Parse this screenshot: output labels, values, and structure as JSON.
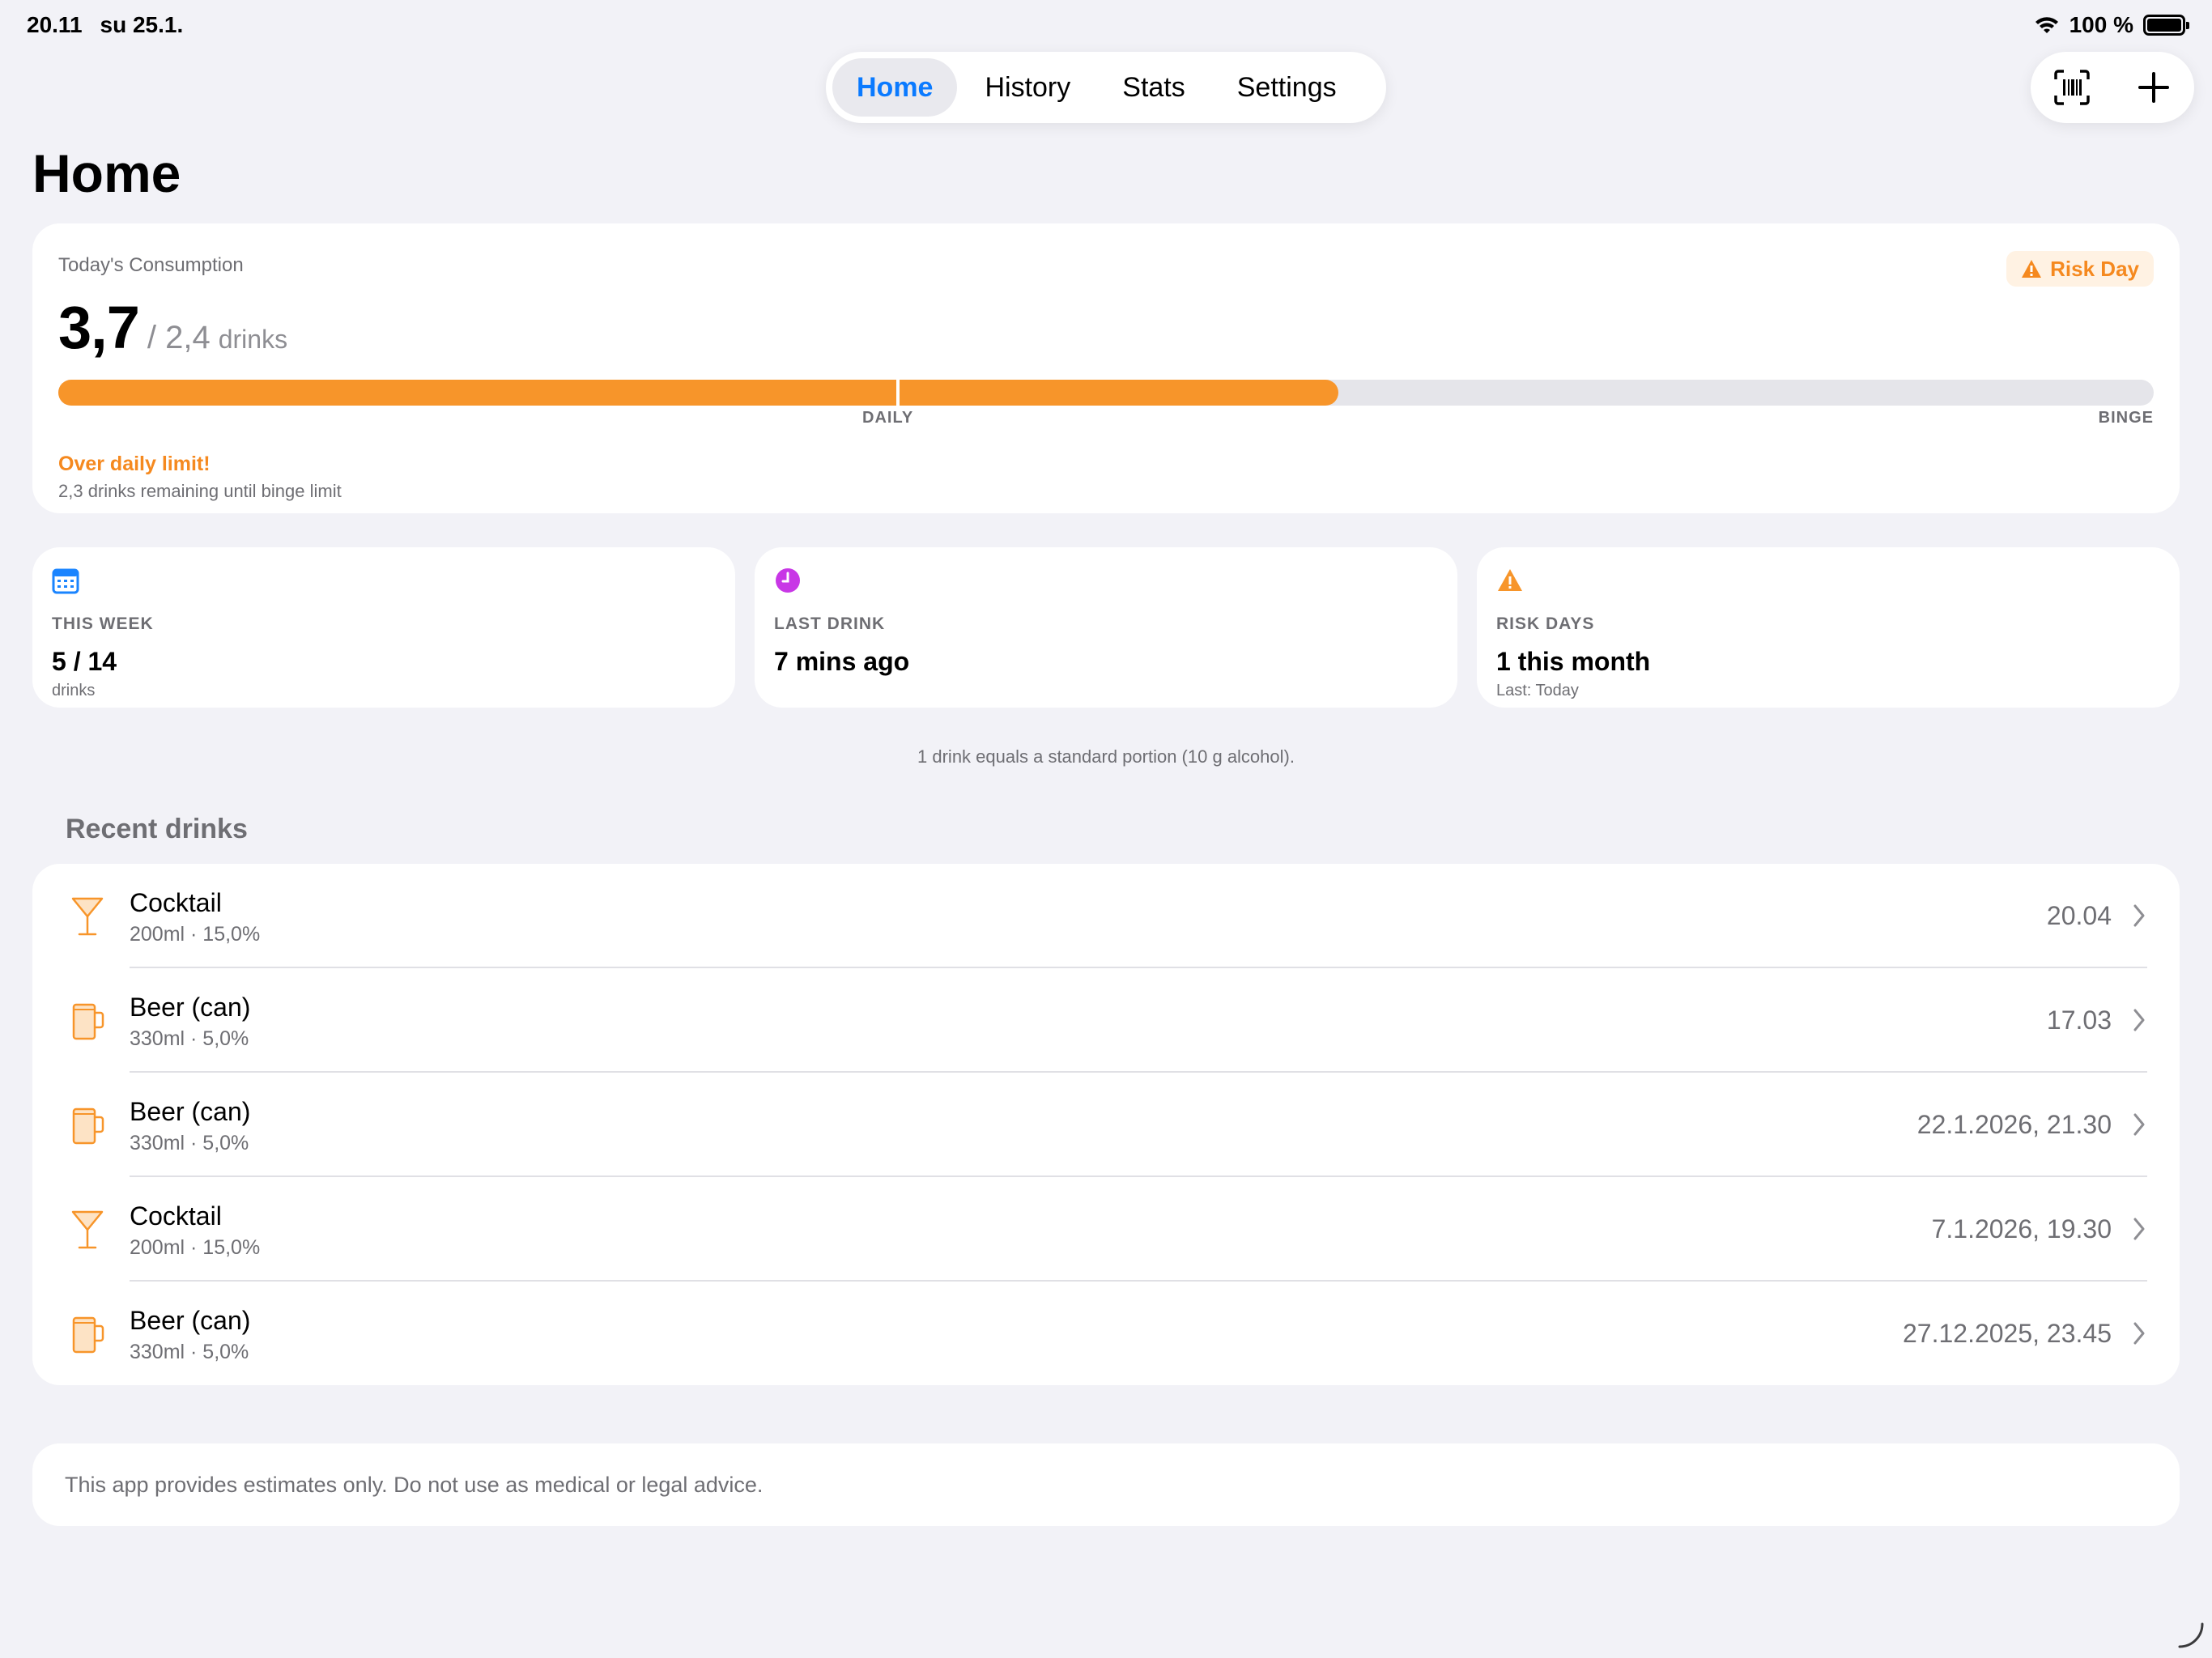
{
  "status": {
    "time": "20.11",
    "date": "su 25.1.",
    "battery": "100 %"
  },
  "tabs": [
    {
      "label": "Home",
      "active": true
    },
    {
      "label": "History",
      "active": false
    },
    {
      "label": "Stats",
      "active": false
    },
    {
      "label": "Settings",
      "active": false
    }
  ],
  "actions": {
    "scan_icon": "barcode-scan-icon",
    "add_icon": "plus-icon"
  },
  "page": {
    "title": "Home"
  },
  "today": {
    "label": "Today's Consumption",
    "badge": "Risk Day",
    "value": "3,7",
    "limit": "/ 2,4",
    "unit": "drinks",
    "progress_fraction": 0.611,
    "daily_fraction": 0.4,
    "daily_label": "DAILY",
    "binge_label": "BINGE",
    "warning": "Over daily limit!",
    "remaining": "2,3 drinks remaining until binge limit"
  },
  "stats": [
    {
      "icon": "calendar-icon",
      "label": "THIS WEEK",
      "value": "5 / 14",
      "sub": "drinks",
      "color": "#1a84ff"
    },
    {
      "icon": "clock-icon",
      "label": "LAST DRINK",
      "value": "7 mins ago",
      "sub": "",
      "color": "#c837e6"
    },
    {
      "icon": "warning-icon",
      "label": "RISK DAYS",
      "value": "1 this month",
      "sub": "Last: Today",
      "color": "#f7952a"
    }
  ],
  "footnote": "1 drink equals a standard portion (10 g alcohol).",
  "recent": {
    "title": "Recent drinks",
    "items": [
      {
        "icon": "cocktail-glass-icon",
        "name": "Cocktail",
        "detail": "200ml · 15,0%",
        "time": "20.04"
      },
      {
        "icon": "beer-mug-icon",
        "name": "Beer (can)",
        "detail": "330ml · 5,0%",
        "time": "17.03"
      },
      {
        "icon": "beer-mug-icon",
        "name": "Beer (can)",
        "detail": "330ml · 5,0%",
        "time": "22.1.2026, 21.30"
      },
      {
        "icon": "cocktail-glass-icon",
        "name": "Cocktail",
        "detail": "200ml · 15,0%",
        "time": "7.1.2026, 19.30"
      },
      {
        "icon": "beer-mug-icon",
        "name": "Beer (can)",
        "detail": "330ml · 5,0%",
        "time": "27.12.2025, 23.45"
      }
    ]
  },
  "disclaimer": "This app provides estimates only. Do not use as medical or legal advice.",
  "colors": {
    "accent": "#0a7aff",
    "warning": "#f7952a",
    "background": "#f2f2f7"
  }
}
